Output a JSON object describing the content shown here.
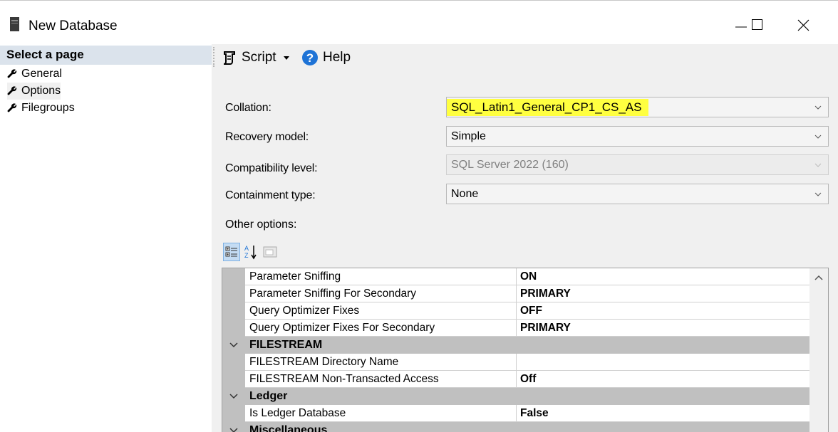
{
  "window": {
    "title": "New Database",
    "minimize_icon": "minimize-icon",
    "maximize_icon": "maximize-icon",
    "close_icon": "close-icon"
  },
  "left_pane": {
    "header": "Select a page",
    "pages": [
      {
        "label": "General",
        "icon": "wrench-icon",
        "selected": false
      },
      {
        "label": "Options",
        "icon": "wrench-icon",
        "selected": true
      },
      {
        "label": "Filegroups",
        "icon": "wrench-icon",
        "selected": false
      }
    ]
  },
  "toolbar": {
    "script_label": "Script",
    "help_label": "Help"
  },
  "form": {
    "collation_label": "Collation:",
    "collation_value": "SQL_Latin1_General_CP1_CS_AS",
    "recovery_label": "Recovery model:",
    "recovery_value": "Simple",
    "compat_label": "Compatibility level:",
    "compat_value": "SQL Server 2022 (160)",
    "containment_label": "Containment type:",
    "containment_value": "None",
    "other_label": "Other options:"
  },
  "colors": {
    "highlight": "#ffff40",
    "panel": "#f0f0f0",
    "header_bg": "#dbe3ec",
    "category_bg": "#c0c0c0"
  },
  "grid": {
    "rows_a": [
      {
        "name": "Parameter Sniffing",
        "value": "ON"
      },
      {
        "name": "Parameter Sniffing For Secondary",
        "value": "PRIMARY"
      },
      {
        "name": "Query Optimizer Fixes",
        "value": "OFF"
      },
      {
        "name": "Query Optimizer Fixes For Secondary",
        "value": "PRIMARY"
      }
    ],
    "cat_filestream": "FILESTREAM",
    "rows_b": [
      {
        "name": "FILESTREAM Directory Name",
        "value": ""
      },
      {
        "name": "FILESTREAM Non-Transacted Access",
        "value": "Off"
      }
    ],
    "cat_ledger": "Ledger",
    "rows_c": [
      {
        "name": "Is Ledger Database",
        "value": "False"
      }
    ],
    "cat_misc": "Miscellaneous"
  }
}
